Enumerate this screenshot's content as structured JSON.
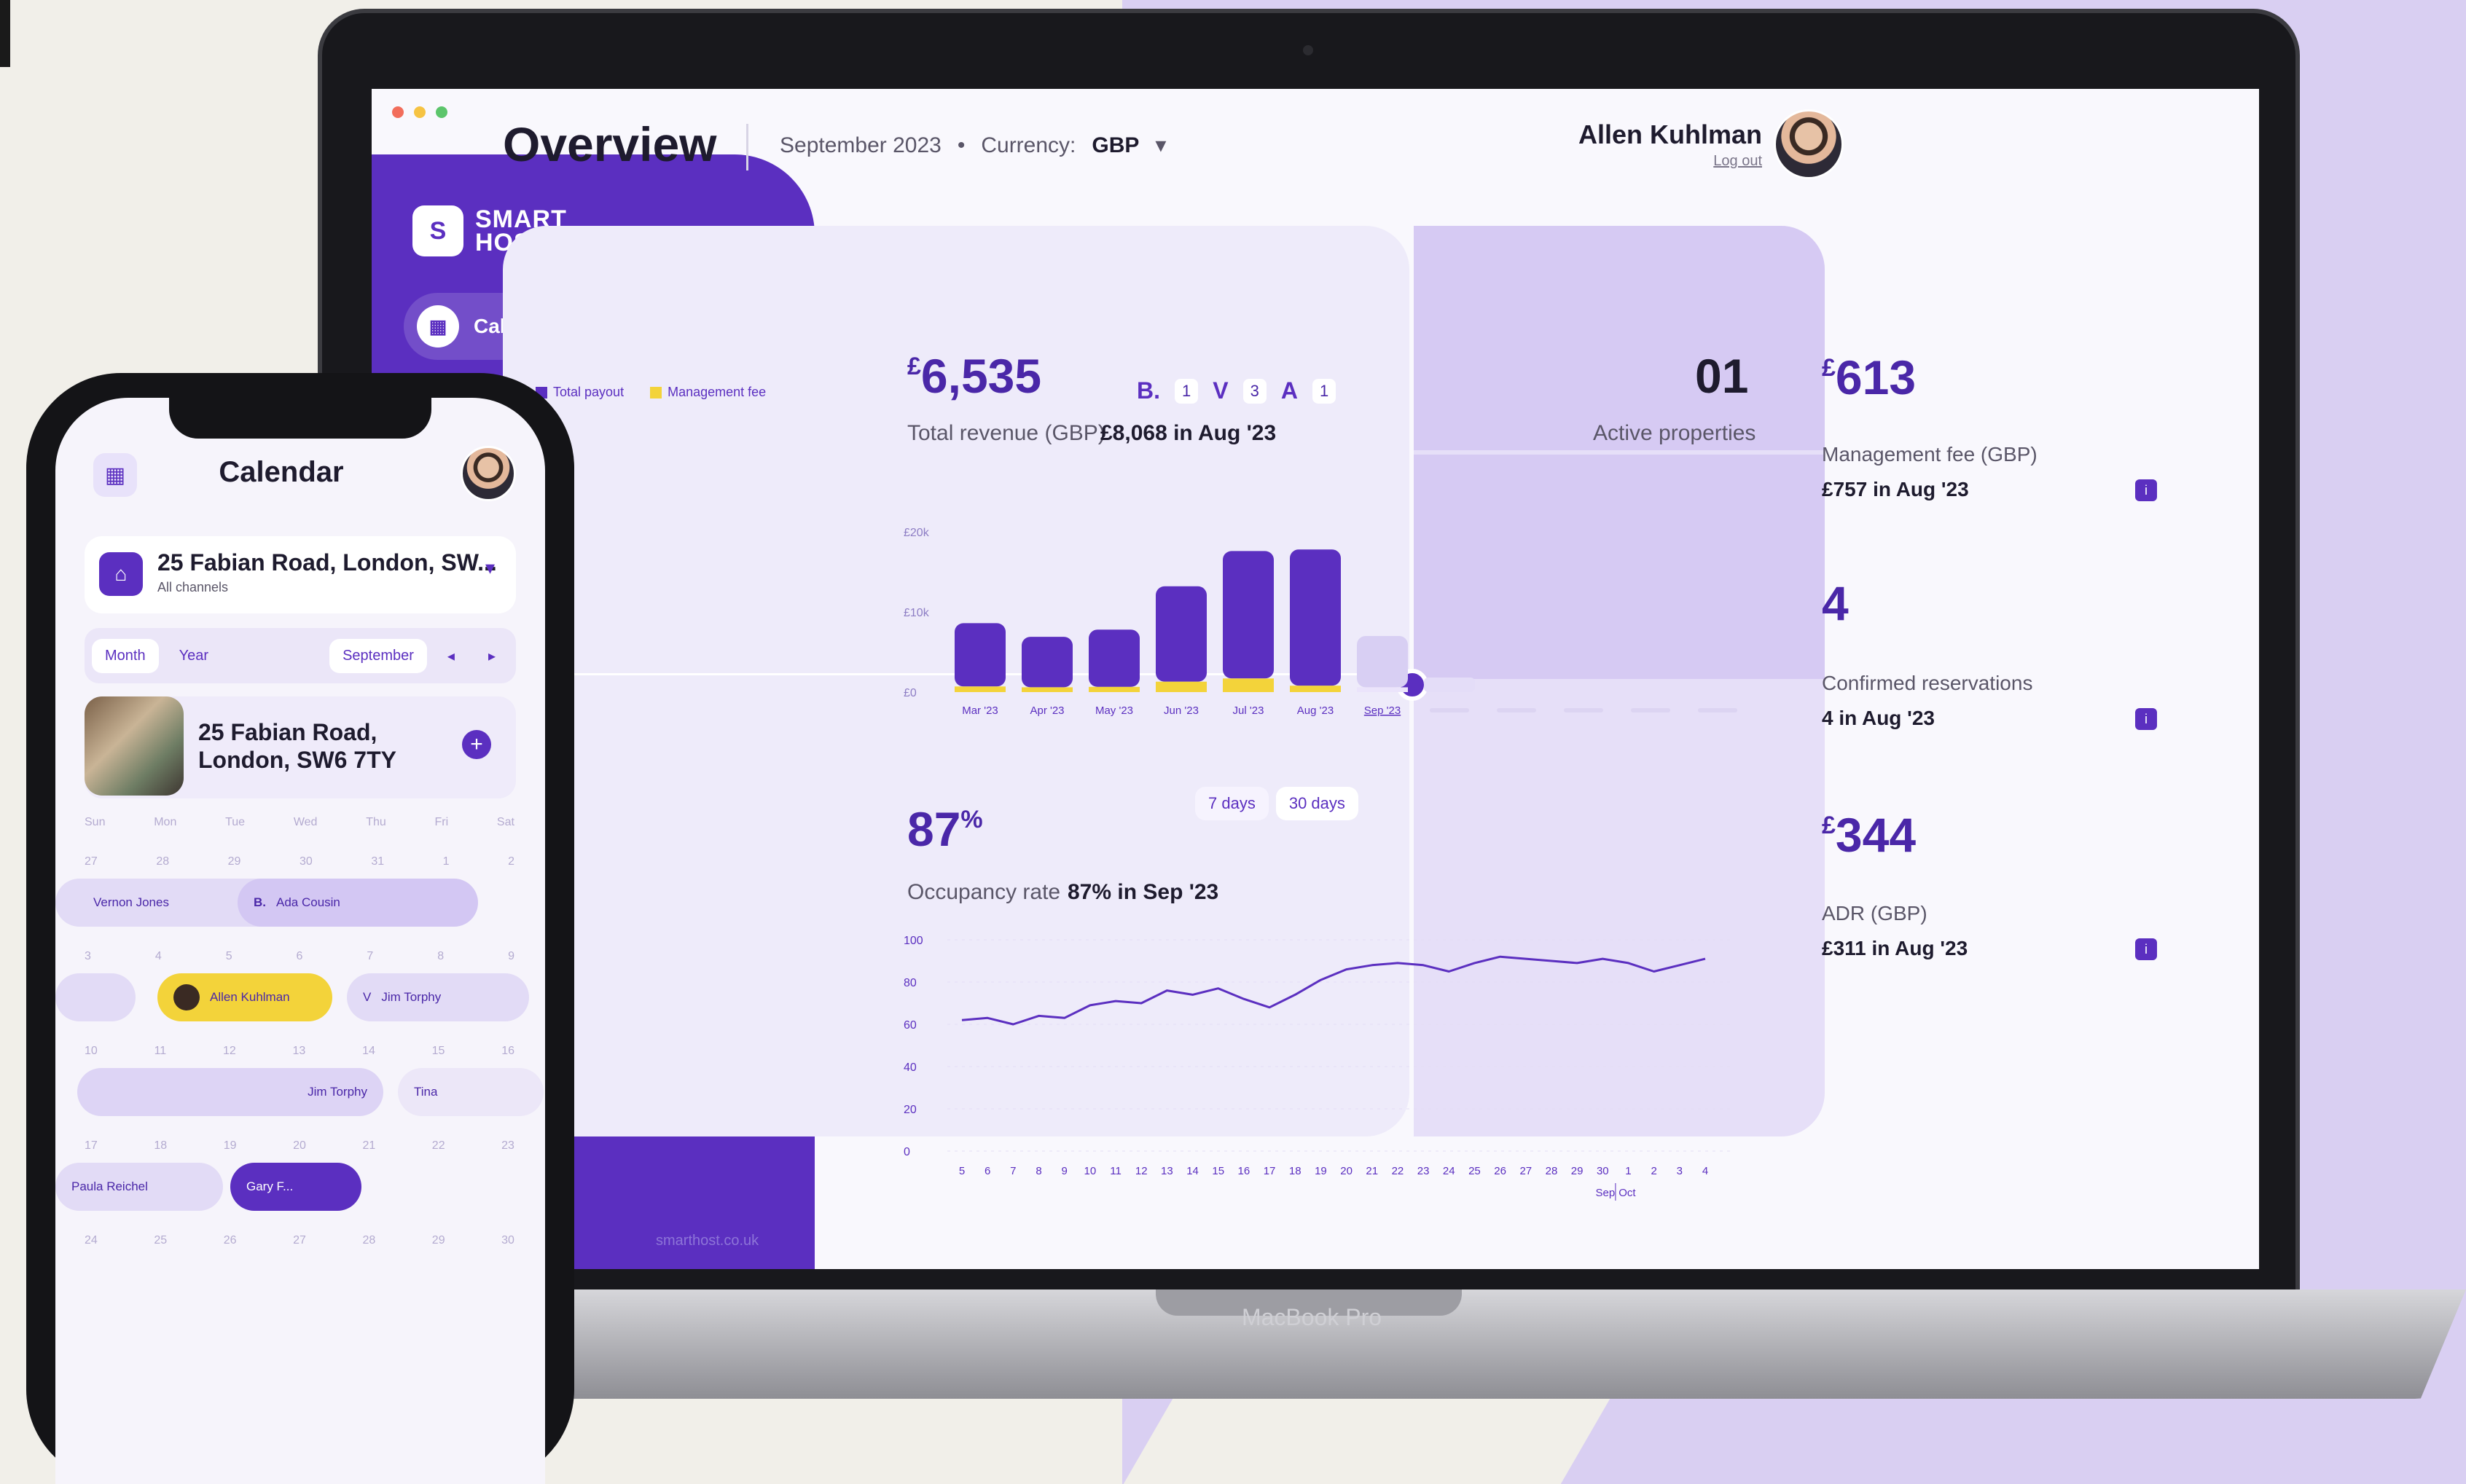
{
  "laptop": {
    "brand_label": "MacBook Pro",
    "window_dot_colors": [
      "#f26d5b",
      "#f6c343",
      "#5cc56b"
    ],
    "sidebar": {
      "logo_line1": "SMART",
      "logo_line2": "HOST.",
      "logo_mark": "S",
      "nav_items": [
        {
          "label": "Calendar",
          "icon": "calendar-icon",
          "badge_icon": "bell-icon"
        }
      ],
      "footer_text": "smarthost.co.uk"
    },
    "header": {
      "title": "Overview",
      "period": "September 2023",
      "separator": "•",
      "currency_label": "Currency:",
      "currency_value": "GBP",
      "currency_chevron": "▾",
      "user_name": "Allen Kuhlman",
      "logout": "Log out"
    },
    "revenue": {
      "currency_symbol": "£",
      "amount": "6,535",
      "label": "Total revenue (GBP)",
      "compare": "£8,068 in Aug '23",
      "active_count": "01",
      "active_label": "Active properties"
    },
    "channels": [
      {
        "icon": "booking-icon",
        "glyph": "B.",
        "count": "1"
      },
      {
        "icon": "vrbo-icon",
        "glyph": "V",
        "count": "3"
      },
      {
        "icon": "airbnb-icon",
        "glyph": "A",
        "count": "1"
      }
    ],
    "occupancy": {
      "value": "87",
      "unit": "%",
      "label": "Occupancy rate",
      "compare": "87% in Sep '23",
      "toggles": [
        {
          "label": "7 days",
          "active": false
        },
        {
          "label": "30 days",
          "active": true
        }
      ]
    },
    "kpis": [
      {
        "currency": "£",
        "value": "613",
        "label": "Management fee (GBP)",
        "compare": "£757 in Aug '23"
      },
      {
        "currency": "",
        "value": "4",
        "label": "Confirmed reservations",
        "compare": "4 in Aug '23"
      },
      {
        "currency": "£",
        "value": "344",
        "label": "ADR (GBP)",
        "compare": "£311 in Aug '23"
      }
    ],
    "info_icon": "i"
  },
  "chart_data": [
    {
      "type": "bar",
      "legend": [
        "Total payout",
        "Management fee"
      ],
      "colors": {
        "payout": "#5b2fc0",
        "fee": "#f3d33a",
        "forecast": "#d8cff3"
      },
      "y_ticks": [
        "£20k",
        "£10k",
        "£0"
      ],
      "ylim": [
        0,
        20000
      ],
      "categories": [
        "Mar '23",
        "Apr '23",
        "May '23",
        "Jun '23",
        "Jul '23",
        "Aug '23",
        "Sep '23"
      ],
      "series": [
        {
          "name": "Total payout",
          "values": [
            8600,
            6900,
            7800,
            13200,
            17600,
            17800,
            7000
          ]
        },
        {
          "name": "Management fee",
          "values": [
            700,
            600,
            650,
            1300,
            1700,
            800,
            600
          ]
        }
      ],
      "forecast_index": 6,
      "trailing_placeholders": 6
    },
    {
      "type": "line",
      "y_ticks": [
        100,
        80,
        60,
        40,
        20,
        0
      ],
      "ylim": [
        0,
        100
      ],
      "x": [
        "5",
        "6",
        "7",
        "8",
        "9",
        "10",
        "11",
        "12",
        "13",
        "14",
        "15",
        "16",
        "17",
        "18",
        "19",
        "20",
        "21",
        "22",
        "23",
        "24",
        "25",
        "26",
        "27",
        "28",
        "29",
        "30",
        "1",
        "2",
        "3",
        "4"
      ],
      "month_labels": [
        "Sep",
        "Oct"
      ],
      "values": [
        62,
        63,
        60,
        64,
        63,
        69,
        71,
        70,
        76,
        74,
        77,
        72,
        68,
        74,
        81,
        86,
        88,
        89,
        88,
        85,
        89,
        92,
        91,
        90,
        89,
        91,
        89,
        85,
        88,
        91
      ],
      "color": "#5b2fc0"
    }
  ],
  "phone": {
    "title": "Calendar",
    "menu_icon": "grid-icon",
    "property_selector": {
      "title": "25 Fabian Road, London, SW...",
      "subtitle": "All channels"
    },
    "controls": [
      "Month",
      "Year",
      "September",
      "◂",
      "▸"
    ],
    "property_card": {
      "title": "25 Fabian Road, London, SW6 7TY",
      "action": "+"
    },
    "weekdays": [
      "Sun",
      "Mon",
      "Tue",
      "Wed",
      "Thu",
      "Fri",
      "Sat"
    ],
    "week_rows": [
      [
        "27",
        "28",
        "29",
        "30",
        "31",
        "1",
        "2"
      ],
      [
        "3",
        "4",
        "5",
        "6",
        "7",
        "8",
        "9"
      ],
      [
        "10",
        "11",
        "12",
        "13",
        "14",
        "15",
        "16"
      ],
      [
        "17",
        "18",
        "19",
        "20",
        "21",
        "22",
        "23"
      ],
      [
        "24",
        "25",
        "26",
        "27",
        "28",
        "29",
        "30"
      ]
    ],
    "bookings": [
      "Vernon Jones",
      "Ada Cousin",
      "Allen Kuhlman",
      "Jim Torphy",
      "Jim Torphy",
      "Tina",
      "Paula Reichel",
      "Gary F..."
    ]
  }
}
